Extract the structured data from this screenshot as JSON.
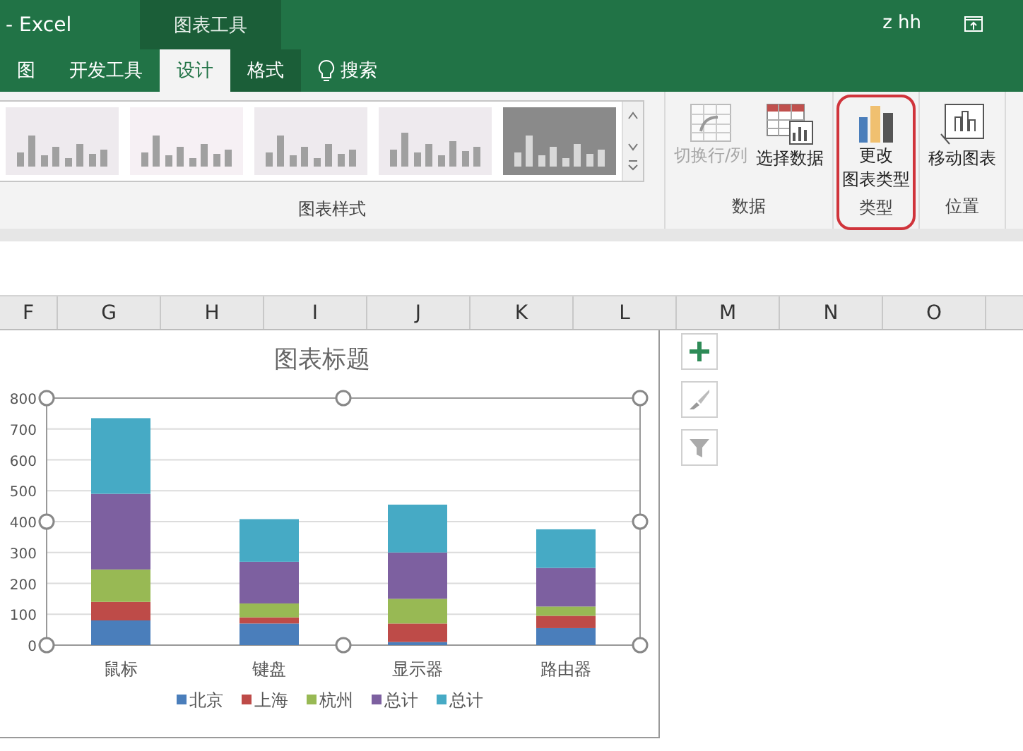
{
  "title_bar": {
    "app": "- Excel",
    "context_tab": "图表工具",
    "user": "z hh"
  },
  "tabs": [
    {
      "label": "图",
      "selected": false,
      "contextual": false
    },
    {
      "label": "开发工具",
      "selected": false,
      "contextual": false
    },
    {
      "label": "设计",
      "selected": true,
      "contextual": true
    },
    {
      "label": "格式",
      "selected": false,
      "contextual": true
    }
  ],
  "search": {
    "label": "搜索"
  },
  "ribbon": [
    {
      "kind": "gallery",
      "label": "图表样式",
      "styles": [
        {
          "kind": "light"
        },
        {
          "kind": "pale"
        },
        {
          "kind": "light"
        },
        {
          "kind": "hatched"
        },
        {
          "kind": "dark"
        }
      ]
    },
    {
      "kind": "buttons",
      "label": "数据",
      "highlighted": false,
      "buttons": [
        {
          "kind": "switch",
          "lines": [
            "切换行/列"
          ],
          "disabled": true
        },
        {
          "kind": "select",
          "lines": [
            "选择数据"
          ],
          "disabled": false
        }
      ]
    },
    {
      "kind": "buttons",
      "label": "类型",
      "highlighted": true,
      "buttons": [
        {
          "kind": "change",
          "lines": [
            "更改",
            "图表类型"
          ],
          "disabled": false
        }
      ]
    },
    {
      "kind": "buttons",
      "label": "位置",
      "highlighted": false,
      "buttons": [
        {
          "kind": "move",
          "lines": [
            "移动图表"
          ],
          "disabled": false
        }
      ]
    }
  ],
  "columns": [
    "F",
    "G",
    "H",
    "I",
    "J",
    "K",
    "L",
    "M",
    "N",
    "O"
  ],
  "chart": {
    "chart_data": {
      "type": "bar",
      "stacked": true,
      "title": "图表标题",
      "categories": [
        "鼠标",
        "键盘",
        "显示器",
        "路由器"
      ],
      "series": [
        {
          "name": "北京",
          "color": "#4a7ebb",
          "values": [
            80,
            70,
            10,
            55
          ]
        },
        {
          "name": "上海",
          "color": "#be4b48",
          "values": [
            60,
            20,
            60,
            40
          ]
        },
        {
          "name": "杭州",
          "color": "#98b954",
          "values": [
            105,
            45,
            80,
            30
          ]
        },
        {
          "name": "总计",
          "color": "#7d60a0",
          "values": [
            245,
            135,
            150,
            125
          ]
        },
        {
          "name": "总计",
          "color": "#46aac5",
          "values": [
            245,
            138,
            155,
            125
          ]
        }
      ],
      "grid": true,
      "legend": true,
      "ylim": [
        0,
        800
      ],
      "yticks": [
        0,
        100,
        200,
        300,
        400,
        500,
        600,
        700,
        800
      ]
    }
  },
  "chart_tools": [
    {
      "kind": "add"
    },
    {
      "kind": "style"
    },
    {
      "kind": "filter"
    }
  ]
}
